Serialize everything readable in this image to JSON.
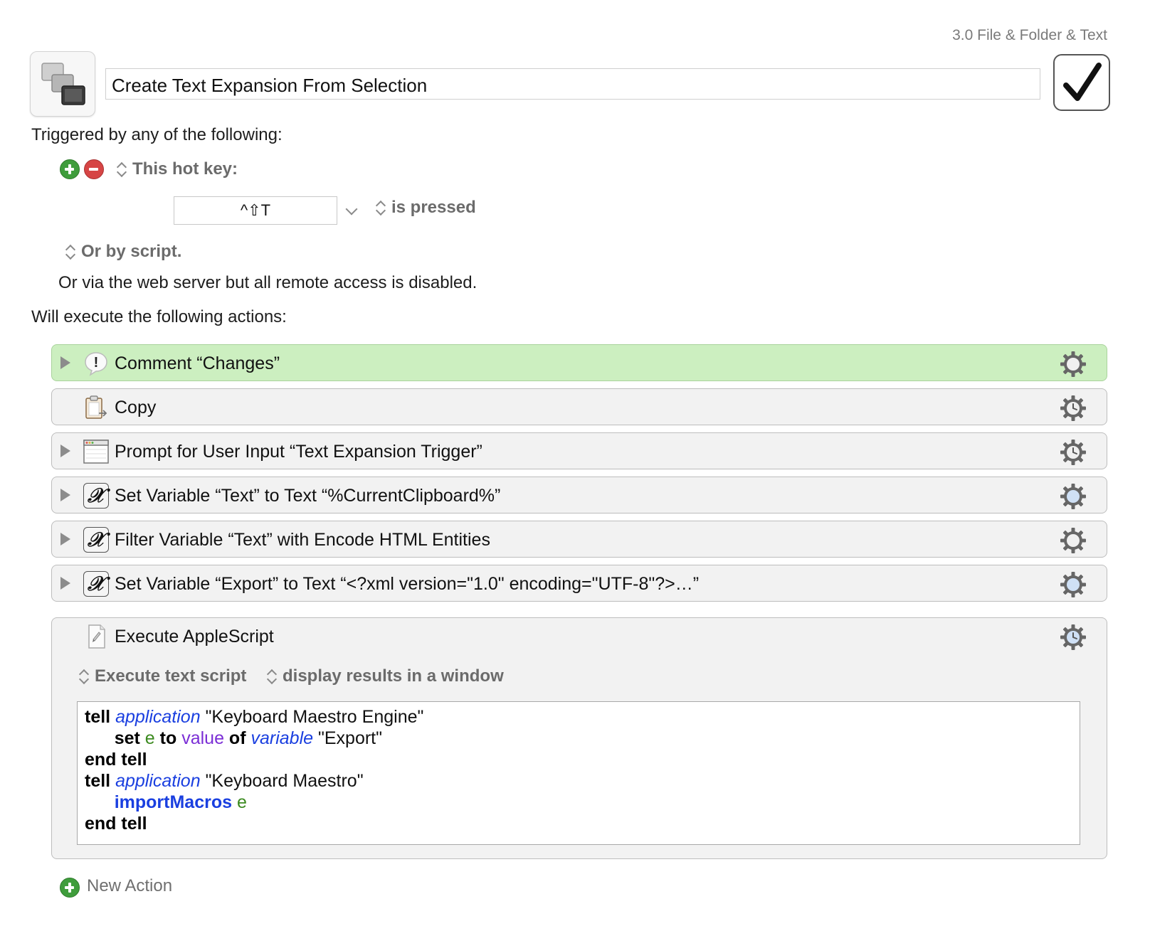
{
  "header": {
    "group_name": "3.0 File & Folder & Text",
    "macro_name": "Create Text Expansion From Selection",
    "enabled": true
  },
  "triggers": {
    "heading": "Triggered by any of the following:",
    "hotkey_trigger_label": "This hot key:",
    "hotkey_value": "^⇧T",
    "hotkey_condition": "is pressed",
    "script_trigger_label": "Or by script.",
    "web_server_note": "Or via the web server but all remote access is disabled."
  },
  "actions": {
    "heading": "Will execute the following actions:",
    "items": [
      {
        "title": "Comment “Changes”",
        "icon": "comment-icon",
        "selected": true
      },
      {
        "title": "Copy",
        "icon": "clipboard-icon",
        "selected": false
      },
      {
        "title": "Prompt for User Input “Text Expansion Trigger”",
        "icon": "window-icon",
        "selected": false
      },
      {
        "title": "Set Variable “Text” to Text “%CurrentClipboard%”",
        "icon": "variable-icon",
        "selected": false
      },
      {
        "title": "Filter Variable “Text” with Encode HTML Entities",
        "icon": "variable-icon",
        "selected": false
      },
      {
        "title": "Set Variable “Export” to Text “<?xml version=\"1.0\" encoding=\"UTF-8\"?>…”",
        "icon": "variable-icon",
        "selected": false
      },
      {
        "title": "Execute AppleScript",
        "icon": "applescript-icon",
        "selected": false,
        "expanded": true
      }
    ],
    "variable_glyph": "𝒳",
    "comment_glyph": "!",
    "applescript_options": {
      "source": "Execute text script",
      "result_mode": "display results in a window"
    },
    "script": {
      "l1_kw": "tell",
      "l1_cls": "application",
      "l1_str": "\"Keyboard Maestro Engine\"",
      "l2_kw1": "set",
      "l2_var": "e",
      "l2_kw2": "to",
      "l2_prop": "value",
      "l2_kw3": "of",
      "l2_cls": "variable",
      "l2_str": "\"Export\"",
      "l3": "end tell",
      "l4_kw": "tell",
      "l4_cls": "application",
      "l4_str": "\"Keyboard Maestro\"",
      "l5_cmd": "importMacros",
      "l5_var": "e",
      "l6": "end tell"
    },
    "new_action_label": "New Action"
  },
  "colors": {
    "selected_action_bg": "#ccefc0",
    "add_button": "#3f9d3c",
    "remove_button": "#d64545",
    "script_class_blue": "#1a3fe0",
    "script_variable_green": "#3b8a1f",
    "script_property_purple": "#7b2ed6"
  }
}
